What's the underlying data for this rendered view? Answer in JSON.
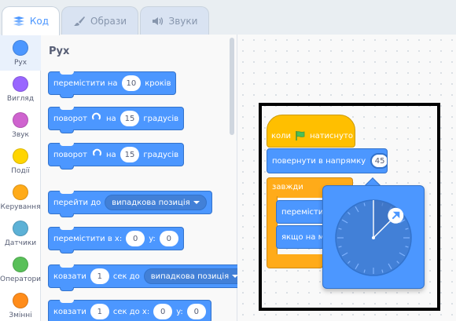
{
  "tabs": [
    {
      "label": "Код",
      "icon": "code-icon",
      "active": true
    },
    {
      "label": "Образи",
      "icon": "brush-icon",
      "active": false
    },
    {
      "label": "Звуки",
      "icon": "speaker-icon",
      "active": false
    }
  ],
  "categories": [
    {
      "label": "Рух",
      "color": "#4c97ff",
      "selected": true
    },
    {
      "label": "Вигляд",
      "color": "#9966ff",
      "selected": false
    },
    {
      "label": "Звук",
      "color": "#cf63cf",
      "selected": false
    },
    {
      "label": "Події",
      "color": "#ffd500",
      "selected": false
    },
    {
      "label": "Керування",
      "color": "#ffab19",
      "selected": false
    },
    {
      "label": "Датчики",
      "color": "#5cb1d6",
      "selected": false
    },
    {
      "label": "Оператори",
      "color": "#59c059",
      "selected": false
    },
    {
      "label": "Змінні",
      "color": "#ff8c1a",
      "selected": false
    }
  ],
  "palette": {
    "title": "Рух",
    "move": {
      "t1": "перемістити на",
      "v": "10",
      "t2": "кроків"
    },
    "turn_right": {
      "t1": "поворот",
      "t2": "на",
      "v": "15",
      "t3": "градусів"
    },
    "turn_left": {
      "t1": "поворот",
      "t2": "на",
      "v": "15",
      "t3": "градусів"
    },
    "goto": {
      "t1": "перейти до",
      "opt": "випадкова позиція"
    },
    "goto_xy": {
      "t1": "перемістити в x:",
      "x": "0",
      "t2": "y:",
      "y": "0"
    },
    "glide": {
      "t1": "ковзати",
      "v": "1",
      "t2": "сек до",
      "opt": "випадкова позиція"
    },
    "glide_xy": {
      "t1": "ковзати",
      "v": "1",
      "t2": "сек до x:",
      "x": "0",
      "t3": "y:",
      "y": "0"
    }
  },
  "script": {
    "hat": {
      "t1": "коли",
      "t2": "натиснуто"
    },
    "point": {
      "t1": "повернути в напрямку",
      "v": "45"
    },
    "forever": "завжди",
    "inner1": "перемістити",
    "inner2": "якщо на межі"
  },
  "dial": {
    "direction": 45
  },
  "colors": {
    "motion": "#4c97ff",
    "events": "#ffbf00",
    "control": "#ffab19",
    "accent": "#4c97ff"
  }
}
